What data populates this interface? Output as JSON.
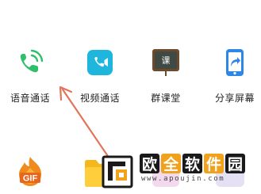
{
  "features": [
    {
      "label": "语音通话",
      "icon": "phone-call-icon"
    },
    {
      "label": "视频通话",
      "icon": "video-call-icon"
    },
    {
      "label": "群课堂",
      "icon": "chalkboard-icon",
      "icon_text": "课"
    },
    {
      "label": "分享屏幕",
      "icon": "share-screen-icon"
    }
  ],
  "bottom_row": [
    {
      "icon": "gif-icon",
      "text": "GIF"
    },
    {
      "icon": "folder-icon"
    },
    {
      "icon": "app-icon-3"
    },
    {
      "icon": "app-icon-4"
    }
  ],
  "watermark": {
    "chars": [
      "欧",
      "全",
      "软",
      "件",
      "园"
    ],
    "url": "www.apoujin.com"
  },
  "colors": {
    "phone_green": "#2fbf6a",
    "video_cyan": "#1fb6dd",
    "share_blue": "#2e86e6",
    "arrow_red": "#e3735a",
    "gif_orange": "#f08a1c",
    "folder_yellow": "#f5b81c"
  }
}
